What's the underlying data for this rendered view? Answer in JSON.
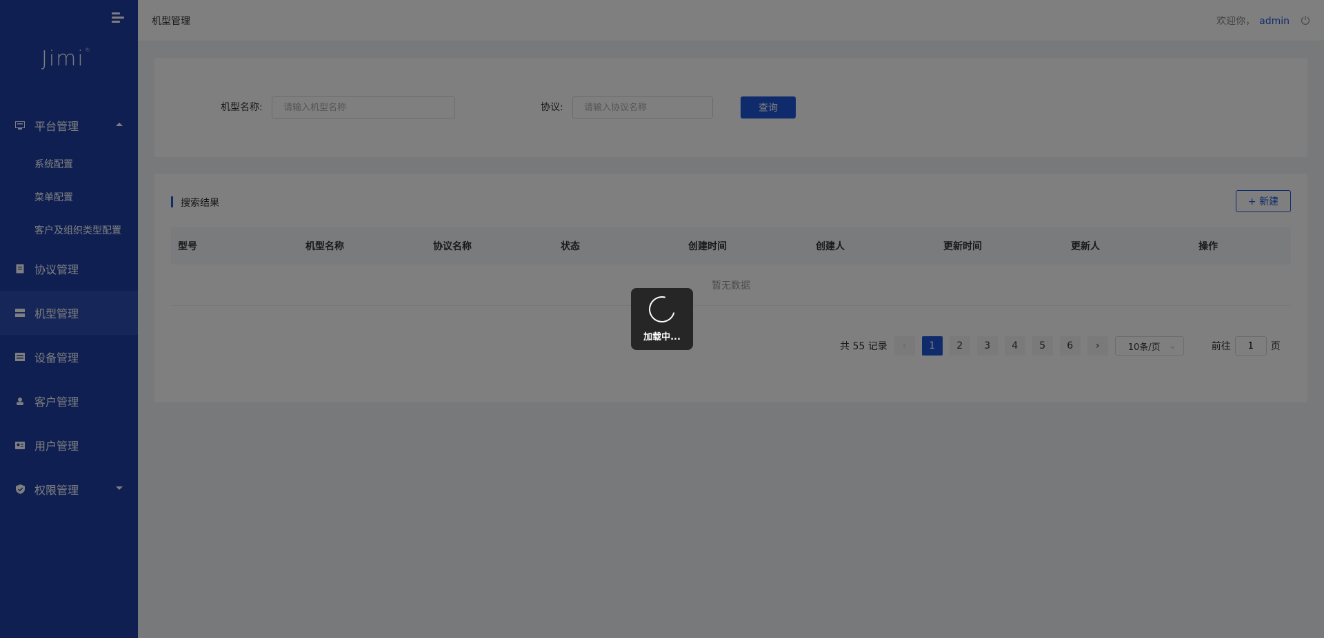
{
  "app": {
    "logo": "Jimi"
  },
  "header": {
    "title": "机型管理",
    "welcome": "欢迎你，",
    "username": "admin"
  },
  "sidebar": {
    "items": [
      {
        "label": "平台管理",
        "icon": "monitor-icon",
        "expanded": true,
        "children": [
          {
            "label": "系统配置"
          },
          {
            "label": "菜单配置"
          },
          {
            "label": "客户及组织类型配置"
          }
        ]
      },
      {
        "label": "协议管理",
        "icon": "document-icon"
      },
      {
        "label": "机型管理",
        "icon": "server-icon",
        "active": true
      },
      {
        "label": "设备管理",
        "icon": "device-icon"
      },
      {
        "label": "客户管理",
        "icon": "person-icon"
      },
      {
        "label": "用户管理",
        "icon": "id-card-icon"
      },
      {
        "label": "权限管理",
        "icon": "shield-icon",
        "expanded": false
      }
    ]
  },
  "search": {
    "model_name_label": "机型名称:",
    "model_name_placeholder": "请输入机型名称",
    "model_name_value": "",
    "protocol_label": "协议:",
    "protocol_placeholder": "请输入协议名称",
    "protocol_value": "",
    "query_button": "查询"
  },
  "results": {
    "title": "搜索结果",
    "new_button": "+ 新建",
    "columns": [
      "型号",
      "机型名称",
      "协议名称",
      "状态",
      "创建时间",
      "创建人",
      "更新时间",
      "更新人",
      "操作"
    ],
    "empty_text": "暂无数据"
  },
  "pagination": {
    "total_text": "共 55 记录",
    "pages": [
      "1",
      "2",
      "3",
      "4",
      "5",
      "6"
    ],
    "current_page": "1",
    "page_size": "10条/页",
    "goto_label": "前往",
    "goto_value": "1",
    "page_suffix": "页"
  },
  "loading": {
    "text": "加载中..."
  },
  "colors": {
    "sidebar": "#1e3fa5",
    "primary": "#1e57d6"
  }
}
